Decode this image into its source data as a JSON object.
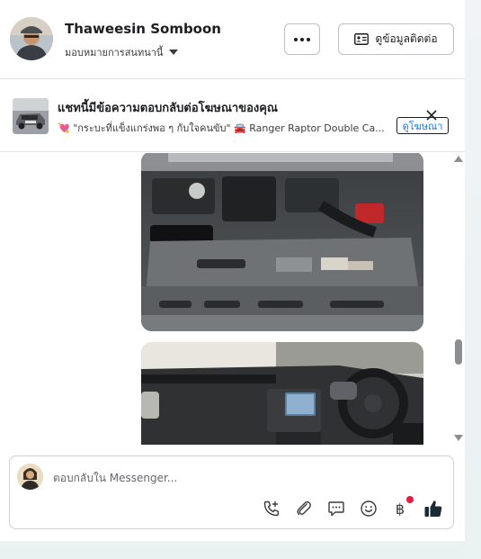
{
  "header": {
    "name": "Thaweesin Somboon",
    "assignment": "มอบหมายการสนทนานี้",
    "more_icon": "more-dots-icon",
    "contact_button": "ดูข้อมูลติดต่อ",
    "contact_icon": "contact-card-icon"
  },
  "ad_banner": {
    "title": "แชทนี้มีข้อความตอบกลับต่อโฆษณาของคุณ",
    "subtitle": "💘 \"กระบะที่แข็งแกร่งพอ ๆ กับใจคนขับ\" 🚘 Ranger Raptor Double Ca...",
    "view_ad": "ดูโฆษณา",
    "close_icon": "close-icon"
  },
  "chat": {
    "images": [
      {
        "content": "engine-bay-photo"
      },
      {
        "content": "dashboard-interior-photo"
      }
    ]
  },
  "composer": {
    "placeholder": "ตอบกลับใน Messenger...",
    "tools": [
      "phone-add-icon",
      "paperclip-icon",
      "saved-reply-icon",
      "emoji-icon",
      "payment-baht-icon",
      "thumbs-up-icon"
    ],
    "baht_symbol": "฿"
  },
  "colors": {
    "accent": "#1877f2",
    "notification": "#e41e3f"
  }
}
